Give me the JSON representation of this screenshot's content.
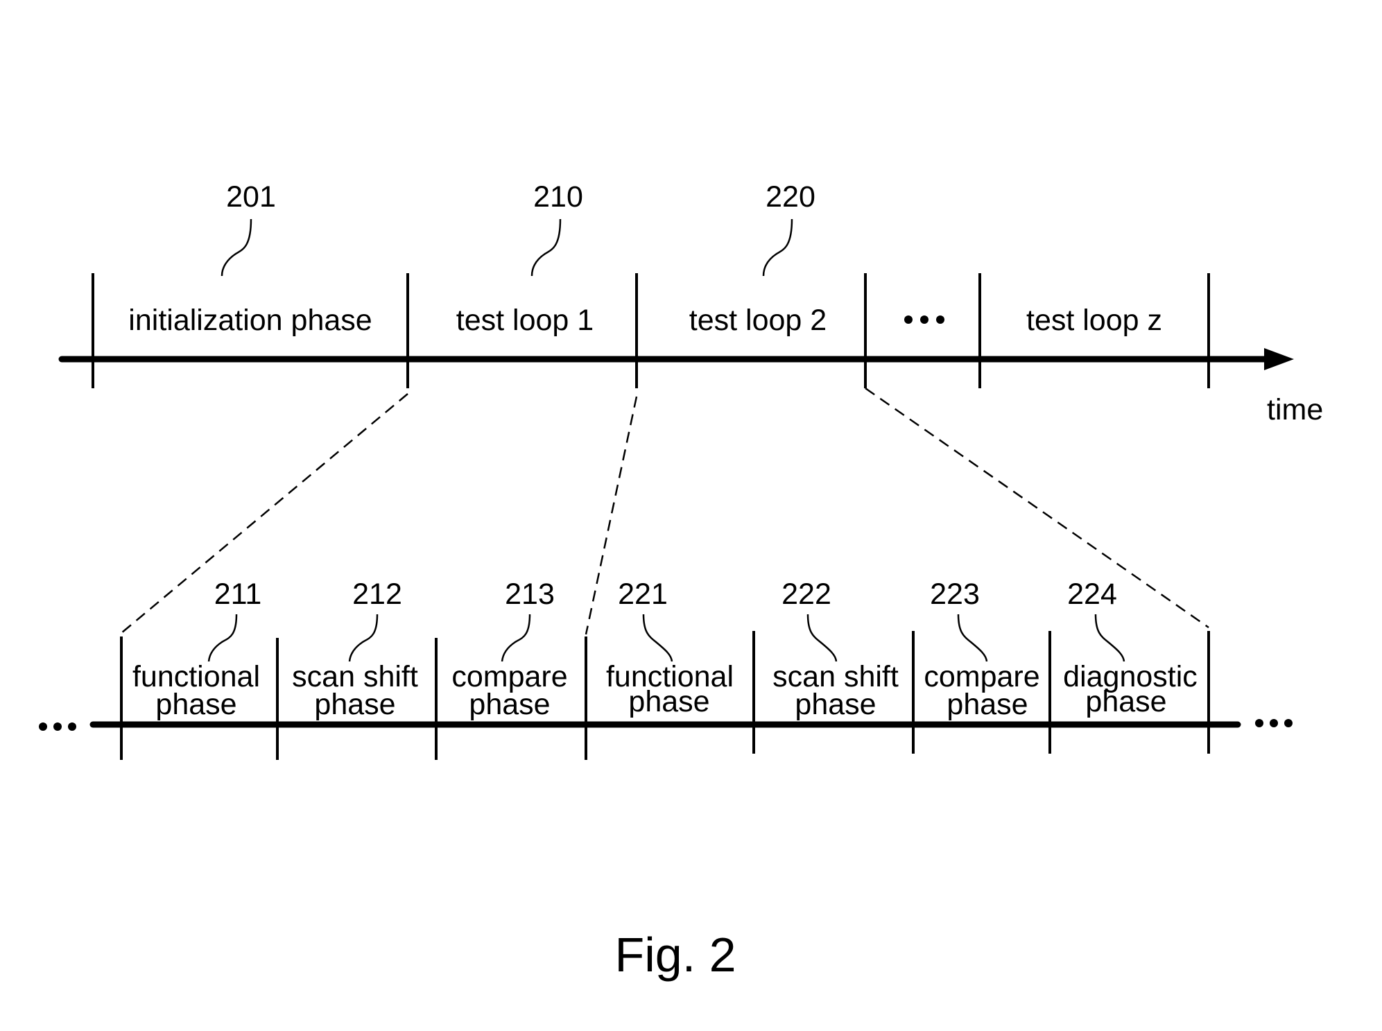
{
  "figure": {
    "caption": "Fig. 2",
    "axis_label": "time",
    "ellipsis": "•••"
  },
  "top_timeline": {
    "segments": [
      {
        "ref": "201",
        "label": "initialization phase"
      },
      {
        "ref": "210",
        "label": "test loop 1"
      },
      {
        "ref": "220",
        "label": "test loop 2"
      },
      {
        "ref": "",
        "label": "•••"
      },
      {
        "ref": "",
        "label": "test loop z"
      }
    ]
  },
  "bottom_timeline": {
    "segments": [
      {
        "ref": "211",
        "line1": "functional",
        "line2": "phase"
      },
      {
        "ref": "212",
        "line1": "scan shift",
        "line2": "phase"
      },
      {
        "ref": "213",
        "line1": "compare",
        "line2": "phase"
      },
      {
        "ref": "221",
        "line1": "functional",
        "line2": "phase"
      },
      {
        "ref": "222",
        "line1": "scan shift",
        "line2": "phase"
      },
      {
        "ref": "223",
        "line1": "compare",
        "line2": "phase"
      },
      {
        "ref": "224",
        "line1": "diagnostic",
        "line2": "phase"
      }
    ]
  }
}
